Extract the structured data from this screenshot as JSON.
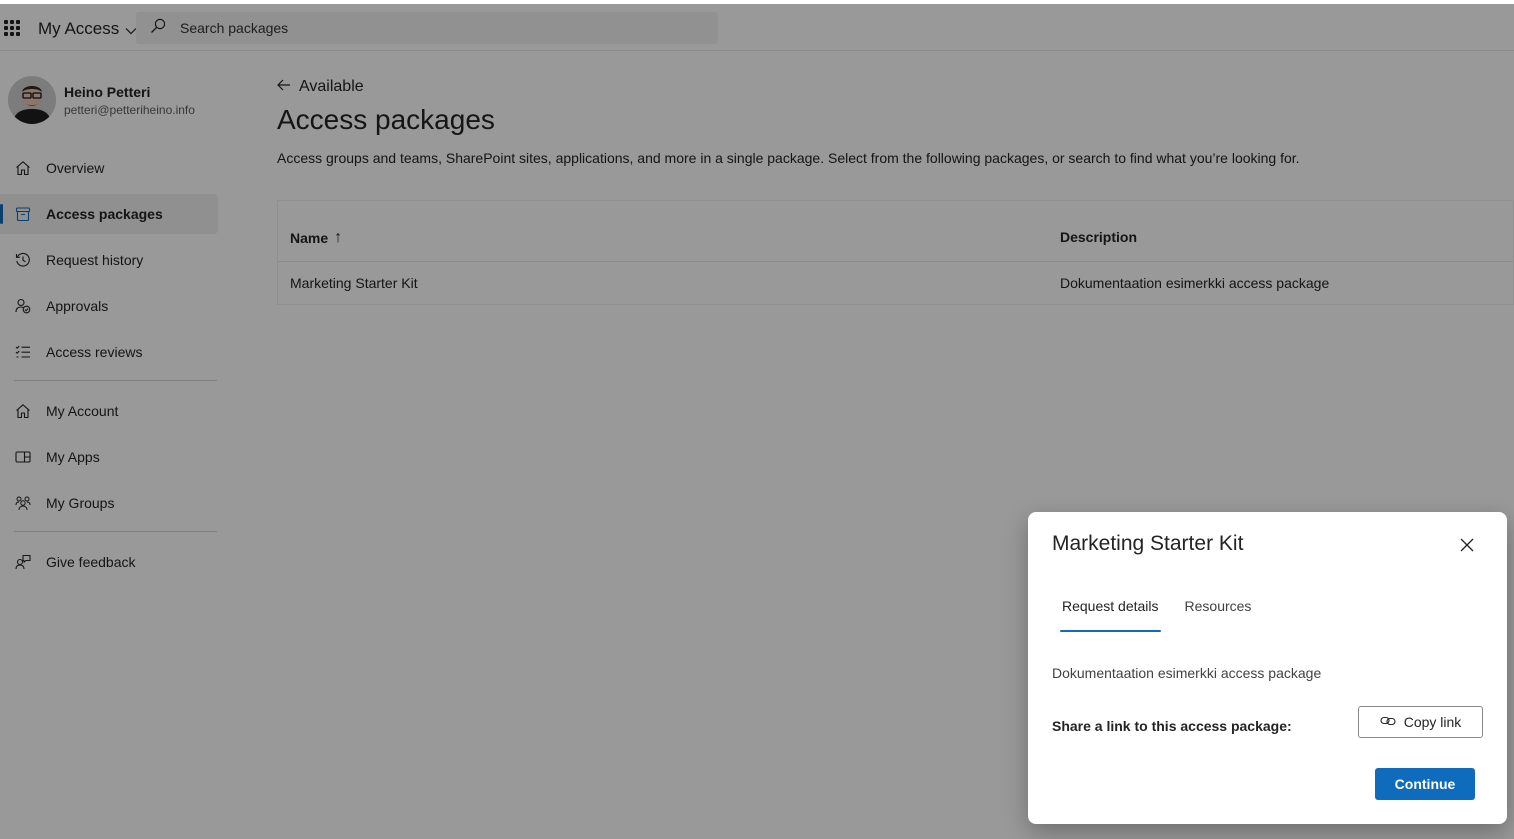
{
  "header": {
    "app_title": "My Access",
    "search_placeholder": "Search packages"
  },
  "profile": {
    "name": "Heino Petteri",
    "email": "petteri@petteriheino.info"
  },
  "sidebar": {
    "items": [
      {
        "label": "Overview",
        "icon": "home-icon",
        "active": false
      },
      {
        "label": "Access packages",
        "icon": "package-icon",
        "active": true
      },
      {
        "label": "Request history",
        "icon": "history-icon",
        "active": false
      },
      {
        "label": "Approvals",
        "icon": "approvals-icon",
        "active": false
      },
      {
        "label": "Access reviews",
        "icon": "checklist-icon",
        "active": false
      },
      {
        "label": "My Account",
        "icon": "home-icon",
        "active": false
      },
      {
        "label": "My Apps",
        "icon": "apps-icon",
        "active": false
      },
      {
        "label": "My Groups",
        "icon": "groups-icon",
        "active": false
      },
      {
        "label": "Give feedback",
        "icon": "feedback-icon",
        "active": false
      }
    ]
  },
  "main": {
    "back_label": "Available",
    "title": "Access packages",
    "description": "Access groups and teams, SharePoint sites, applications, and more in a single package. Select from the following packages, or search to find what you’re looking for.",
    "table": {
      "columns": [
        "Name",
        "Description"
      ],
      "sort_indicator": "↑",
      "rows": [
        {
          "name": "Marketing Starter Kit",
          "description": "Dokumentaation esimerkki access package"
        }
      ]
    }
  },
  "dialog": {
    "title": "Marketing Starter Kit",
    "tabs": [
      {
        "label": "Request details",
        "active": true
      },
      {
        "label": "Resources",
        "active": false
      }
    ],
    "description": "Dokumentaation esimerkki access package",
    "share_label": "Share a link to this access package:",
    "copy_link_label": "Copy link",
    "continue_label": "Continue"
  },
  "colors": {
    "accent": "#0f6cbd",
    "overlay": "rgba(0,0,0,0.40)"
  }
}
